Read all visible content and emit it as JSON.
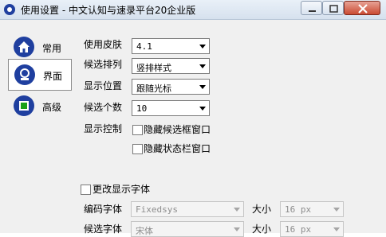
{
  "window": {
    "title": "使用设置 - 中文认知与速录平台20企业版"
  },
  "nav": [
    {
      "label": "常用",
      "icon": "home-icon"
    },
    {
      "label": "界面",
      "icon": "display-icon"
    },
    {
      "label": "高级",
      "icon": "advanced-icon"
    }
  ],
  "settings": {
    "skin_label": "使用皮肤",
    "skin_value": "4.1",
    "layout_label": "候选排列",
    "layout_value": "竖排样式",
    "position_label": "显示位置",
    "position_value": "跟随光标",
    "count_label": "候选个数",
    "count_value": "10",
    "control_label": "显示控制",
    "hide_candidate_label": "隐藏候选框窗口",
    "hide_status_label": "隐藏状态栏窗口"
  },
  "font": {
    "change_label": "更改显示字体",
    "code_font_label": "编码字体",
    "code_font_value": "Fixedsys",
    "code_size_label": "大小",
    "code_size_value": "16 px",
    "cand_font_label": "候选字体",
    "cand_font_value": "宋体",
    "cand_size_label": "大小",
    "cand_size_value": "16 px"
  },
  "colors": {
    "accent": "#1f3f9f",
    "active_green": "#18a018"
  }
}
